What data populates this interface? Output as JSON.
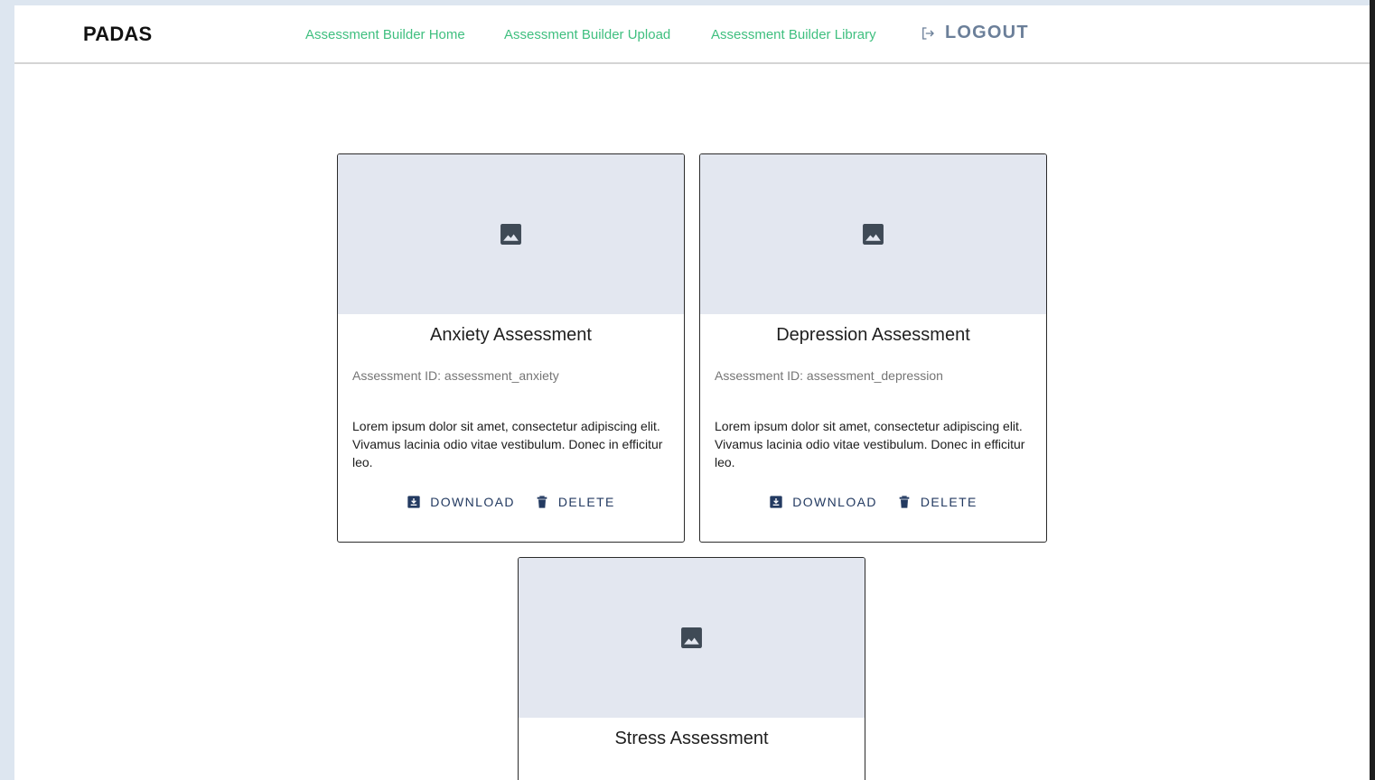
{
  "nav": {
    "brand": "PADAS",
    "links": [
      {
        "label": "Assessment Builder Home"
      },
      {
        "label": "Assessment Builder Upload"
      },
      {
        "label": "Assessment Builder Library"
      }
    ],
    "logout_label": "LOGOUT"
  },
  "cards": [
    {
      "title": "Anxiety Assessment",
      "id_text": "Assessment ID: assessment_anxiety",
      "description": "Lorem ipsum dolor sit amet, consectetur adipiscing elit. Vivamus lacinia odio vitae vestibulum. Donec in efficitur leo.",
      "download_label": "DOWNLOAD",
      "delete_label": "DELETE"
    },
    {
      "title": "Depression Assessment",
      "id_text": "Assessment ID: assessment_depression",
      "description": "Lorem ipsum dolor sit amet, consectetur adipiscing elit. Vivamus lacinia odio vitae vestibulum. Donec in efficitur leo.",
      "download_label": "DOWNLOAD",
      "delete_label": "DELETE"
    },
    {
      "title": "Stress Assessment"
    }
  ],
  "icons": {
    "placeholder": "image-icon",
    "logout": "logout-icon",
    "download": "download-icon",
    "delete": "trash-icon"
  },
  "colors": {
    "nav_link": "#3fbf7f",
    "logout": "#6b7f99",
    "action": "#233a61",
    "media_bg": "#e3e7f0",
    "page_bg": "#dde6f0"
  }
}
